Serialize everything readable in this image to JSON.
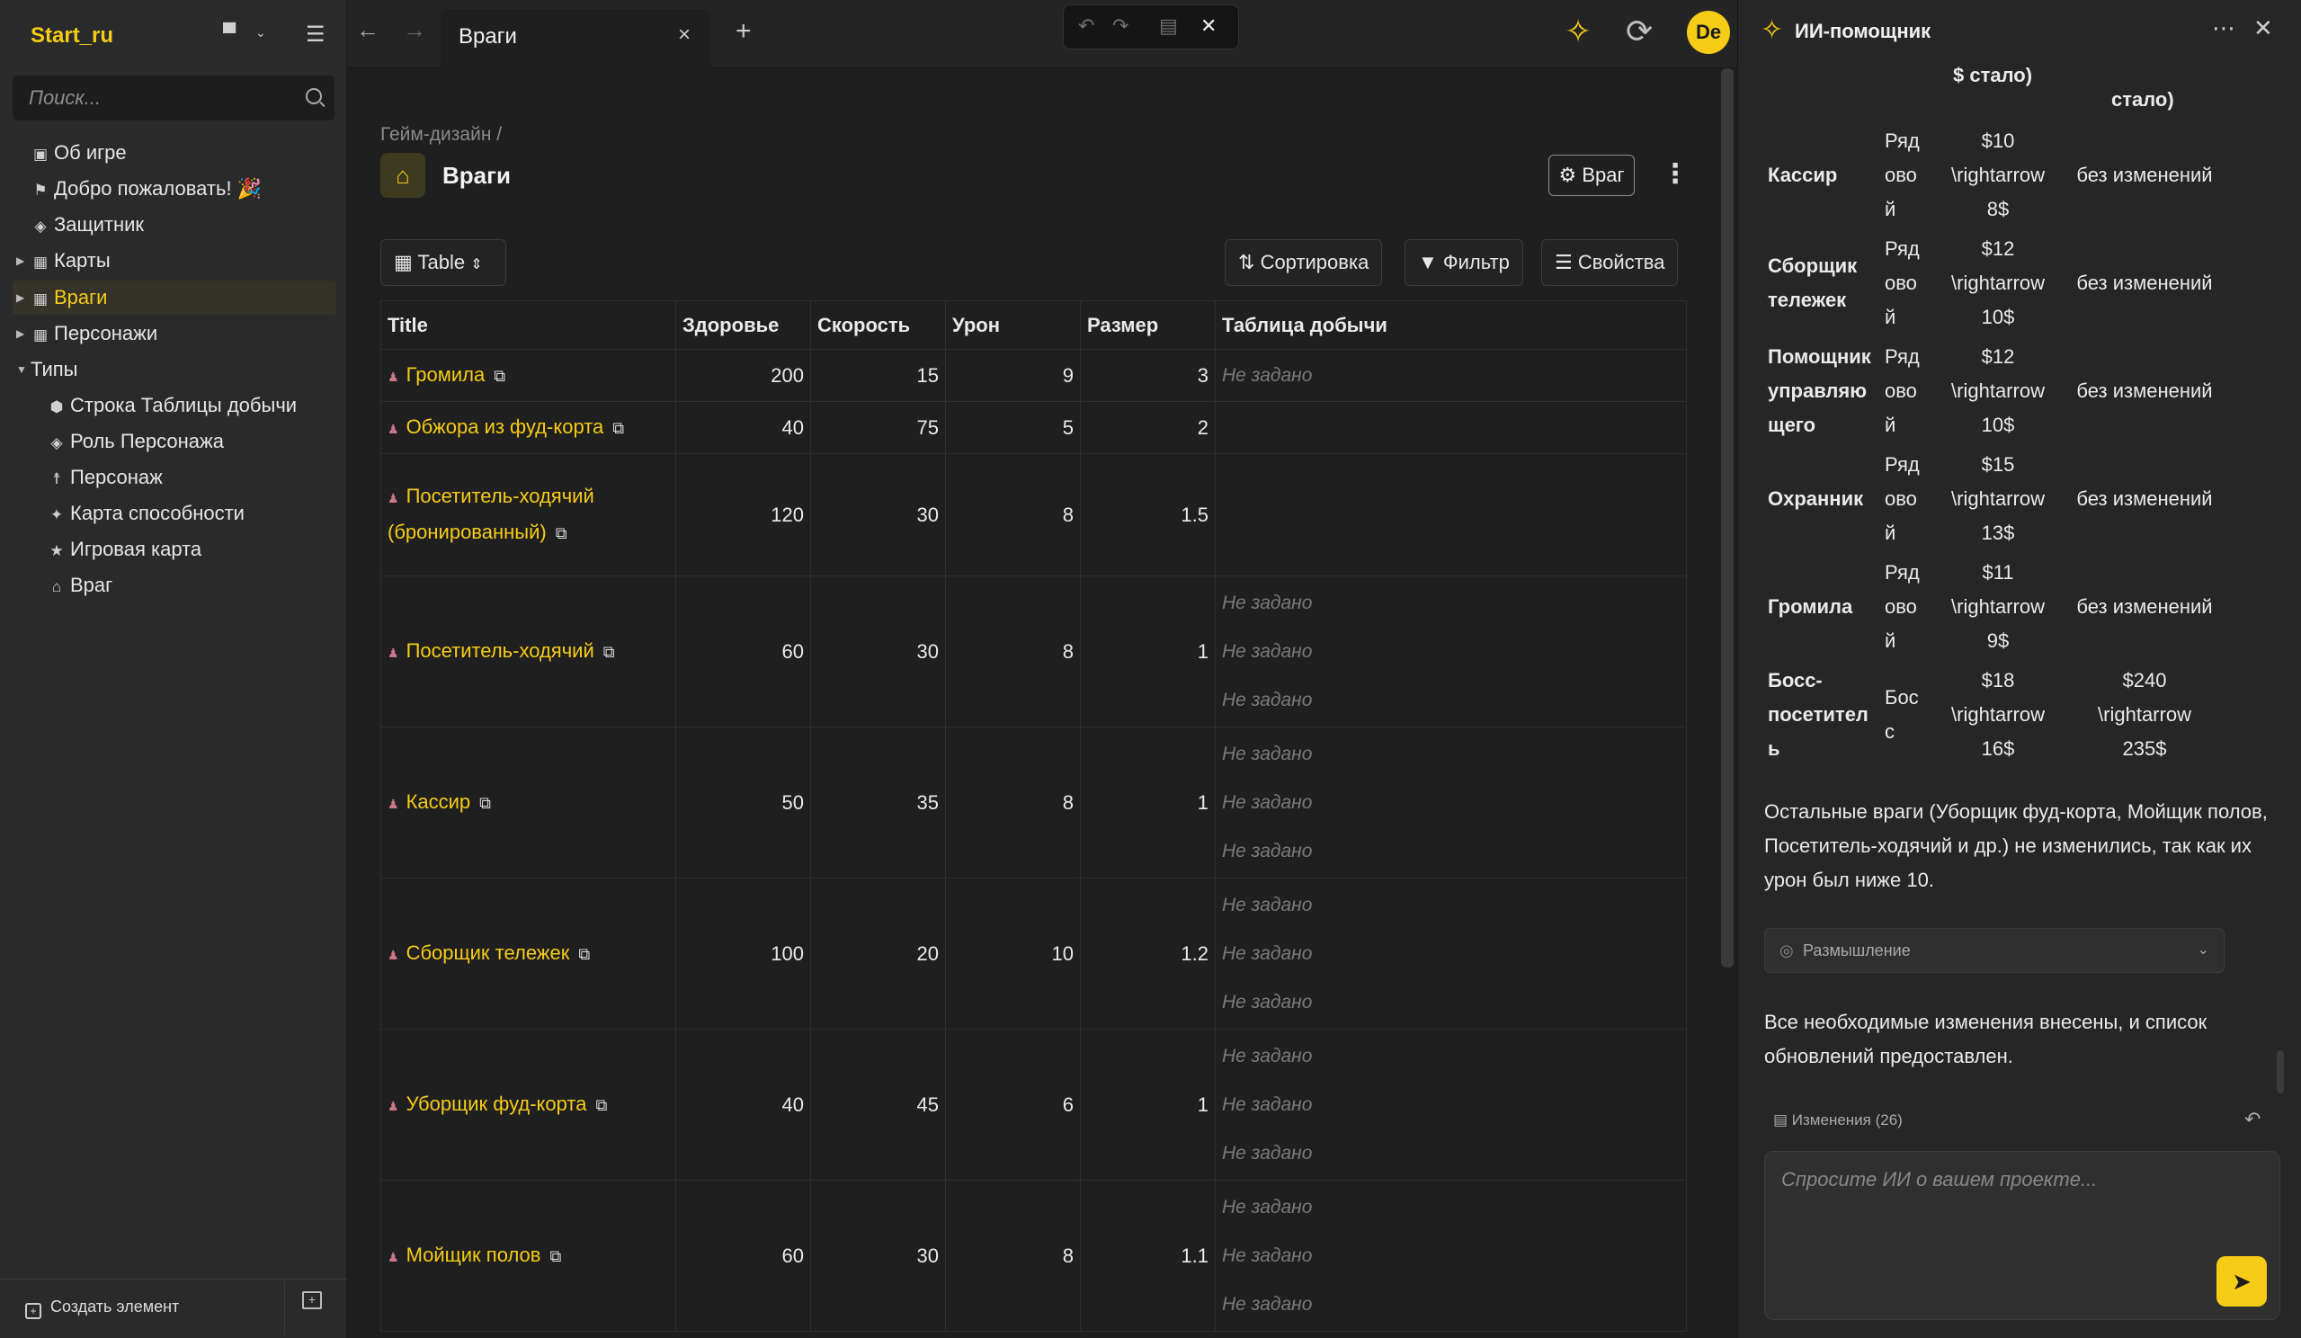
{
  "workspace": {
    "name": "Start_ru"
  },
  "search": {
    "placeholder": "Поиск..."
  },
  "tree": [
    {
      "label": "Об игре",
      "icon": "▣"
    },
    {
      "label": "Добро пожаловать! 🎉",
      "icon": "⚑"
    },
    {
      "label": "Защитник",
      "icon": "◈"
    },
    {
      "label": "Карты",
      "icon": "▦"
    },
    {
      "label": "Враги",
      "icon": "▦"
    },
    {
      "label": "Персонажи",
      "icon": "▦"
    },
    {
      "label": "Типы",
      "icon": ""
    },
    {
      "label": "Строка Таблицы добычи",
      "icon": "⬢"
    },
    {
      "label": "Роль Персонажа",
      "icon": "◈"
    },
    {
      "label": "Персонаж",
      "icon": "☨"
    },
    {
      "label": "Карта способности",
      "icon": "✦"
    },
    {
      "label": "Игровая карта",
      "icon": "★"
    },
    {
      "label": "Враг",
      "icon": "⌂"
    }
  ],
  "sidebar_bottom": {
    "create_label": "Создать элемент"
  },
  "tabs": [
    {
      "label": "Враги"
    }
  ],
  "header": {
    "avatar_initials": "De"
  },
  "page": {
    "breadcrumb": "Гейм-дизайн /",
    "title": "Враги",
    "type_button": "Враг"
  },
  "toolbar": {
    "view_label": "Table",
    "sort_label": "Сортировка",
    "filter_label": "Фильтр",
    "props_label": "Свойства"
  },
  "table": {
    "columns": [
      "Title",
      "Здоровье",
      "Скорость",
      "Урон",
      "Размер",
      "Таблица добычи"
    ],
    "empty_label": "Не задано",
    "rows": [
      {
        "title": "Громила",
        "hp": "200",
        "speed": "15",
        "dmg": "9",
        "size": "3",
        "loot": [
          "Не задано"
        ]
      },
      {
        "title": "Обжора из фуд-корта",
        "hp": "40",
        "speed": "75",
        "dmg": "5",
        "size": "2",
        "loot": []
      },
      {
        "title": "Посетитель-ходячий (бронированный)",
        "hp": "120",
        "speed": "30",
        "dmg": "8",
        "size": "1.5",
        "loot": []
      },
      {
        "title": "Посетитель-ходячий",
        "hp": "60",
        "speed": "30",
        "dmg": "8",
        "size": "1",
        "loot": [
          "Не задано",
          "Не задано",
          "Не задано"
        ]
      },
      {
        "title": "Кассир",
        "hp": "50",
        "speed": "35",
        "dmg": "8",
        "size": "1",
        "loot": [
          "Не задано",
          "Не задано",
          "Не задано"
        ]
      },
      {
        "title": "Сборщик тележек",
        "hp": "100",
        "speed": "20",
        "dmg": "10",
        "size": "1.2",
        "loot": [
          "Не задано",
          "Не задано",
          "Не задано"
        ]
      },
      {
        "title": "Уборщик фуд-корта",
        "hp": "40",
        "speed": "45",
        "dmg": "6",
        "size": "1",
        "loot": [
          "Не задано",
          "Не задано",
          "Не задано"
        ]
      },
      {
        "title": "Мойщик полов",
        "hp": "60",
        "speed": "30",
        "dmg": "8",
        "size": "1.1",
        "loot": [
          "Не задано",
          "Не задано",
          "Не задано"
        ]
      }
    ]
  },
  "ai": {
    "title": "ИИ-помощник",
    "header_fragment_1": "$ стало)",
    "header_fragment_2": "стало)",
    "rows": [
      {
        "name": [
          "Кассир"
        ],
        "type": [
          "Ряд",
          "ово",
          "й"
        ],
        "dmg": [
          "$10",
          "\\rightarrow",
          "8$"
        ],
        "hp": [
          "без изменений"
        ]
      },
      {
        "name": [
          "Сборщик",
          "тележек"
        ],
        "type": [
          "Ряд",
          "ово",
          "й"
        ],
        "dmg": [
          "$12",
          "\\rightarrow",
          "10$"
        ],
        "hp": [
          "без изменений"
        ]
      },
      {
        "name": [
          "Помощник",
          "управляю",
          "щего"
        ],
        "type": [
          "Ряд",
          "ово",
          "й"
        ],
        "dmg": [
          "$12",
          "\\rightarrow",
          "10$"
        ],
        "hp": [
          "без изменений"
        ]
      },
      {
        "name": [
          "Охранник"
        ],
        "type": [
          "Ряд",
          "ово",
          "й"
        ],
        "dmg": [
          "$15",
          "\\rightarrow",
          "13$"
        ],
        "hp": [
          "без изменений"
        ]
      },
      {
        "name": [
          "Громила"
        ],
        "type": [
          "Ряд",
          "ово",
          "й"
        ],
        "dmg": [
          "$11",
          "\\rightarrow",
          "9$"
        ],
        "hp": [
          "без изменений"
        ]
      },
      {
        "name": [
          "Босс-",
          "посетител",
          "ь"
        ],
        "type": [
          "Бос",
          "с"
        ],
        "dmg": [
          "$18",
          "\\rightarrow",
          "16$"
        ],
        "hp": [
          "$240",
          "\\rightarrow",
          "235$"
        ]
      }
    ],
    "para1": "Остальные враги (Уборщик фуд-корта, Мойщик полов, Посетитель-ходячий и др.) не изменились, так как их урон был ниже 10.",
    "thinking_label": "Размышление",
    "para2": "Все необходимые изменения внесены, и список обновлений предоставлен.",
    "changes_label": "Изменения (26)",
    "input_placeholder": "Спросите ИИ о вашем проекте..."
  }
}
